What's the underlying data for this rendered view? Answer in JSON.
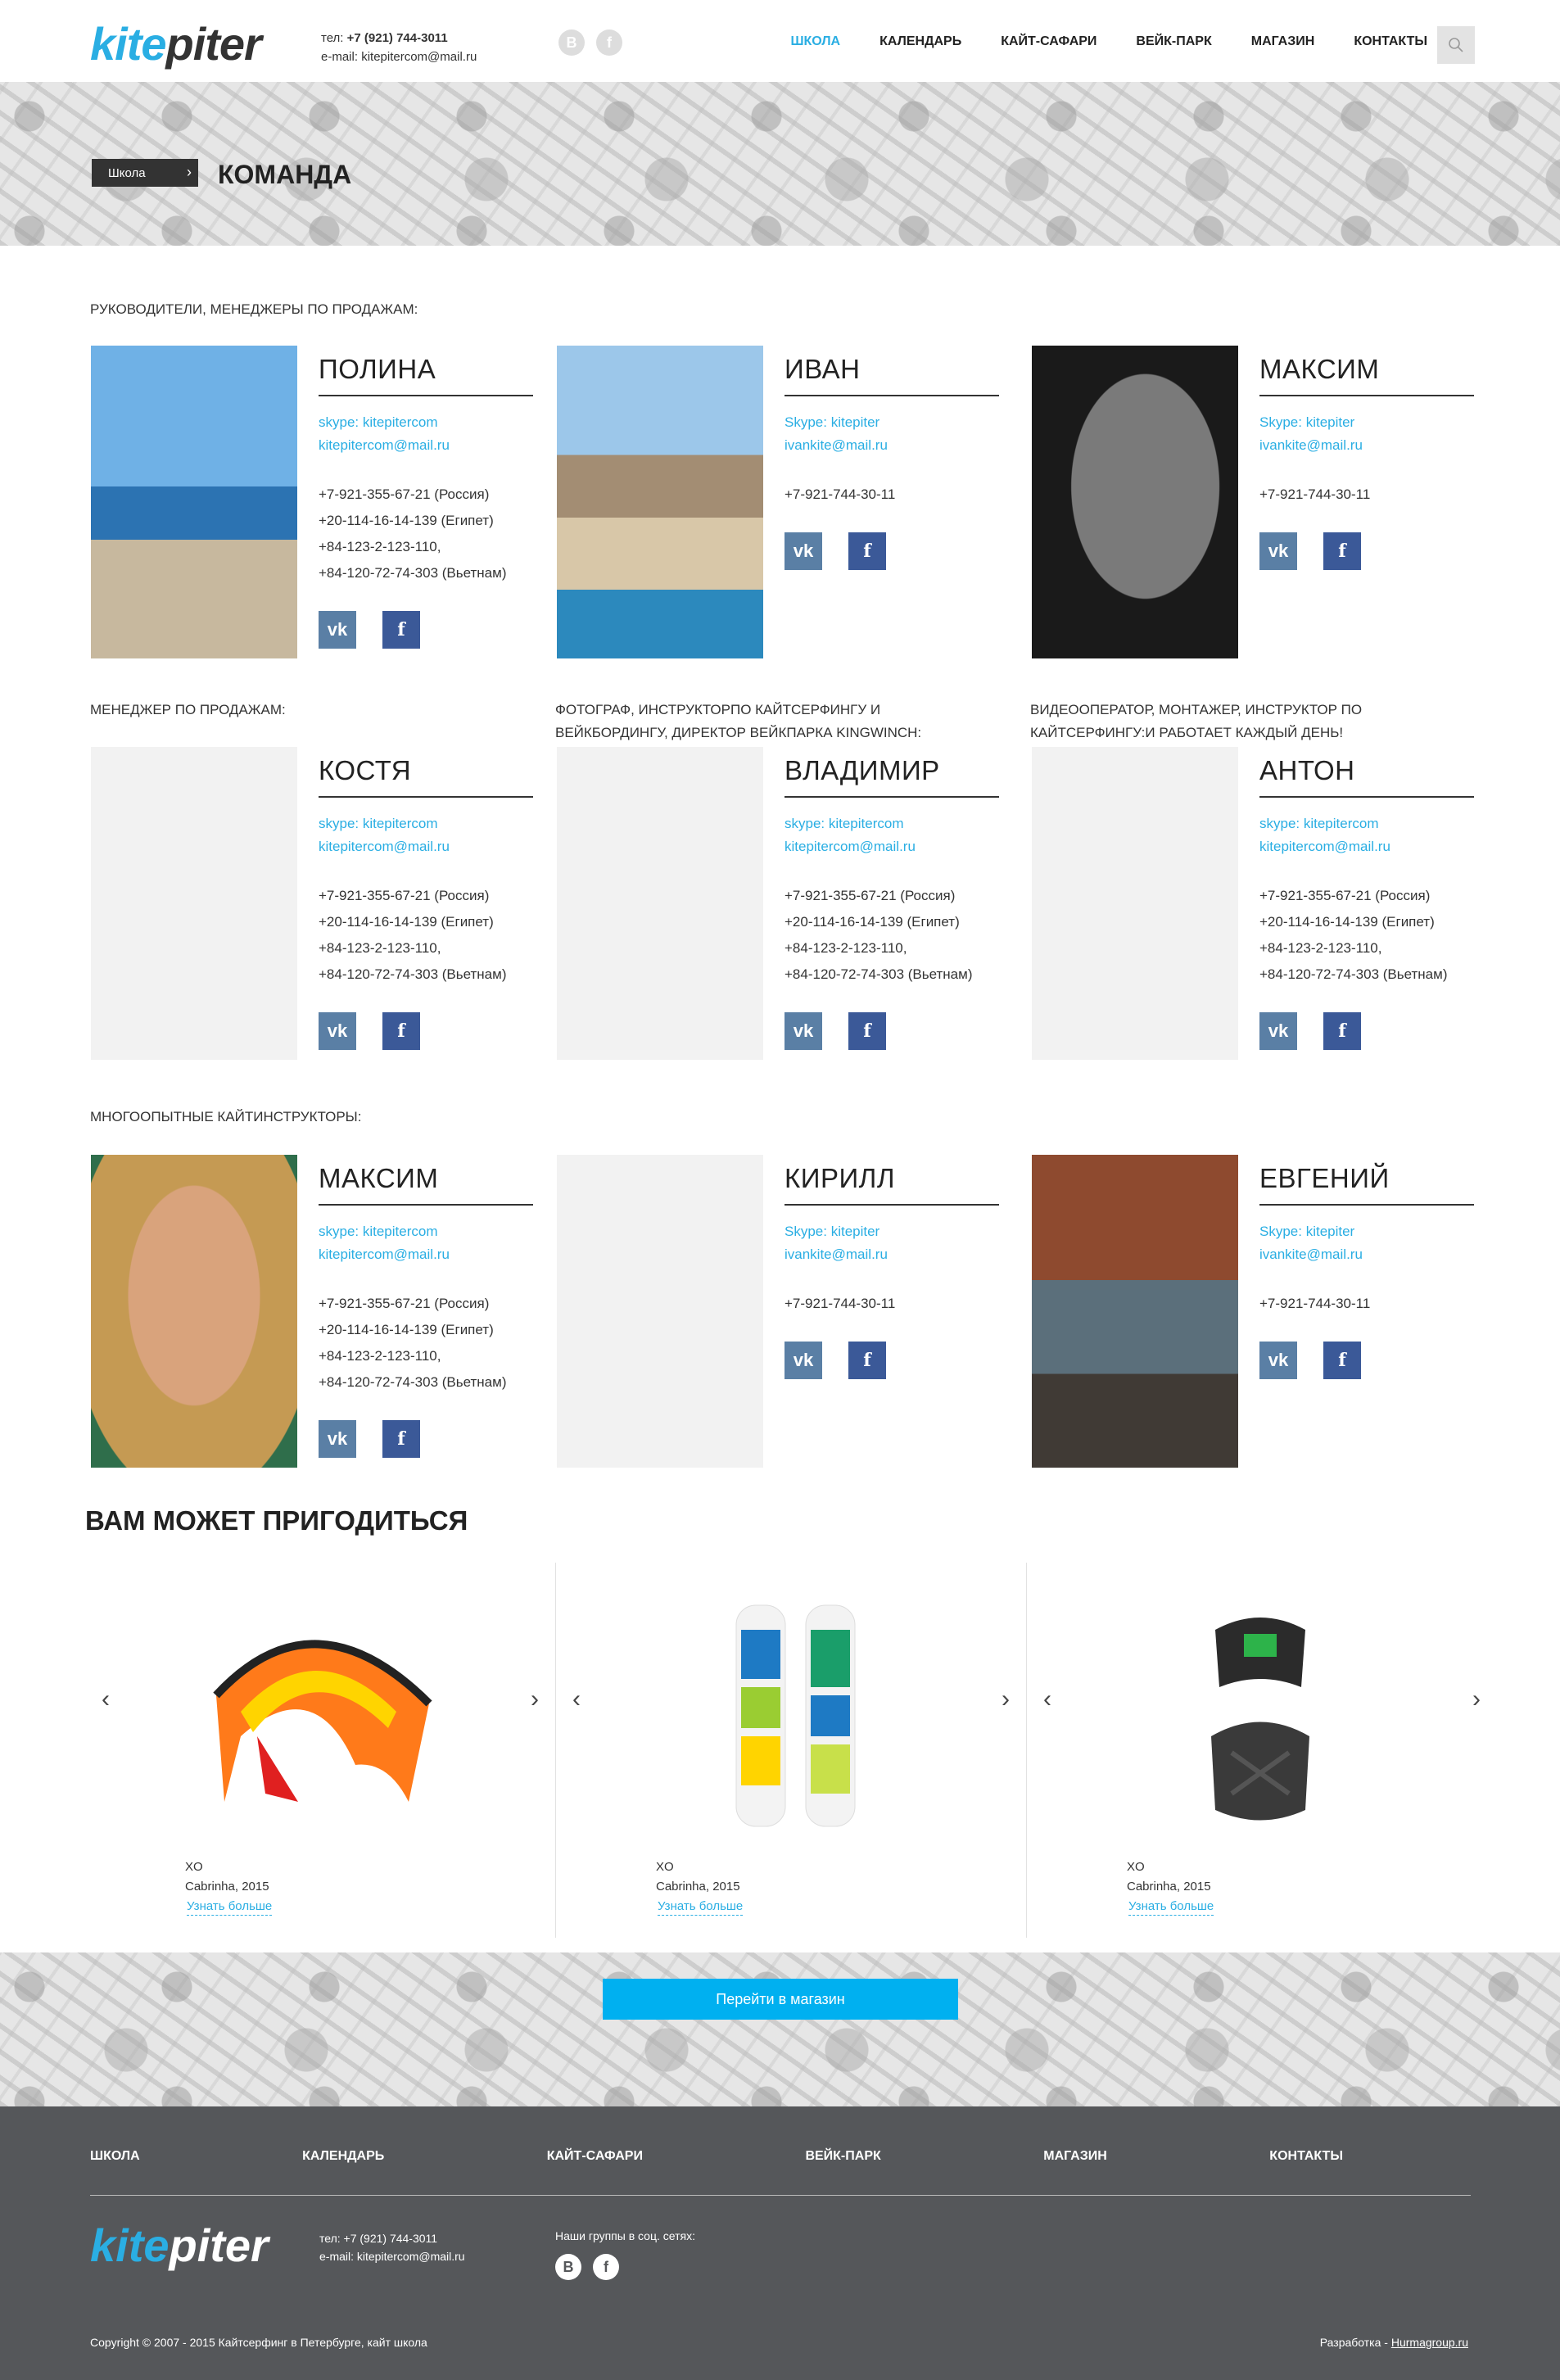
{
  "header": {
    "logo_kite": "kite",
    "logo_piter": "piter",
    "phone_label": "тел:",
    "phone": "+7 (921) 744-3011",
    "email_label": "e-mail:",
    "email": "kitepitercom@mail.ru",
    "social": [
      "В",
      "f"
    ],
    "nav": [
      "ШКОЛА",
      "КАЛЕНДАРЬ",
      "КАЙТ-САФАРИ",
      "ВЕЙК-ПАРК",
      "МАГАЗИН",
      "КОНТАКТЫ"
    ]
  },
  "title_band": {
    "breadcrumb": "Школа",
    "title": "КОМАНДА"
  },
  "team": {
    "group1_label": "РУКОВОДИТЕЛИ, МЕНЕДЖЕРЫ ПО ПРОДАЖАМ:",
    "group2a_label": "МЕНЕДЖЕР ПО ПРОДАЖАМ:",
    "group2b_label": "ФОТОГРАФ, ИНСТРУКТОРПО КАЙТСЕРФИНГУ И ВЕЙКБОРДИНГУ, ДИРЕКТОР ВЕЙКПАРКА KINGWINCH:",
    "group2c_label": "ВИДЕООПЕРАТОР, МОНТАЖЕР, ИНСТРУКТОР ПО КАЙТСЕРФИНГУ:и работает каждый день!",
    "group3_label": "МНОГООПЫТНЫЕ КАЙТИНСТРУКТОРЫ:",
    "members": [
      {
        "name": "ПОЛИНА",
        "skype": "skype: kitepitercom",
        "email": "kitepitercom@mail.ru",
        "phones": [
          "+7-921-355-67-21  (Россия)",
          "+20-114-16-14-139  (Египет)",
          "+84-123-2-123-110,",
          "+84-120-72-74-303  (Вьетнам)"
        ]
      },
      {
        "name": "ИВАН",
        "skype": "Skype: kitepiter",
        "email": "ivankite@mail.ru",
        "phones": [
          "+7-921-744-30-11"
        ]
      },
      {
        "name": "МАКСИМ",
        "skype": "Skype: kitepiter",
        "email": "ivankite@mail.ru",
        "phones": [
          "+7-921-744-30-11"
        ]
      },
      {
        "name": "КОСТЯ",
        "skype": "skype: kitepitercom",
        "email": "kitepitercom@mail.ru",
        "phones": [
          "+7-921-355-67-21  (Россия)",
          "+20-114-16-14-139  (Египет)",
          "+84-123-2-123-110,",
          "+84-120-72-74-303  (Вьетнам)"
        ]
      },
      {
        "name": "ВЛАДИМИР",
        "skype": "skype: kitepitercom",
        "email": "kitepitercom@mail.ru",
        "phones": [
          "+7-921-355-67-21  (Россия)",
          "+20-114-16-14-139  (Египет)",
          "+84-123-2-123-110,",
          "+84-120-72-74-303  (Вьетнам)"
        ]
      },
      {
        "name": "АНТОН",
        "skype": "skype: kitepitercom",
        "email": "kitepitercom@mail.ru",
        "phones": [
          "+7-921-355-67-21  (Россия)",
          "+20-114-16-14-139  (Египет)",
          "+84-123-2-123-110,",
          "+84-120-72-74-303  (Вьетнам)"
        ]
      },
      {
        "name": "МАКСИМ",
        "skype": "skype: kitepitercom",
        "email": "kitepitercom@mail.ru",
        "phones": [
          "+7-921-355-67-21  (Россия)",
          "+20-114-16-14-139  (Египет)",
          "+84-123-2-123-110,",
          "+84-120-72-74-303  (Вьетнам)"
        ]
      },
      {
        "name": "КИРИЛЛ",
        "skype": "Skype: kitepiter",
        "email": "ivankite@mail.ru",
        "phones": [
          "+7-921-744-30-11"
        ]
      },
      {
        "name": "ЕВГЕНИЙ",
        "skype": "Skype: kitepiter",
        "email": "ivankite@mail.ru",
        "phones": [
          "+7-921-744-30-11"
        ]
      }
    ],
    "vk_glyph": "vk",
    "fb_glyph": "f"
  },
  "products": {
    "title": "ВАМ МОЖЕТ ПРИГОДИТЬСЯ",
    "items": [
      {
        "name": "XO",
        "brand": "Cabrinha, 2015",
        "more": "Узнать больше",
        "icon": "kite-icon"
      },
      {
        "name": "XO",
        "brand": "Cabrinha, 2015",
        "more": "Узнать больше",
        "icon": "kiteboard-icon"
      },
      {
        "name": "XO",
        "brand": "Cabrinha, 2015",
        "more": "Узнать больше",
        "icon": "harness-icon"
      }
    ],
    "prev": "‹",
    "next": "›",
    "shop_button": "Перейти в магазин"
  },
  "footer": {
    "nav": [
      "ШКОЛА",
      "КАЛЕНДАРЬ",
      "КАЙТ-САФАРИ",
      "ВЕЙК-ПАРК",
      "МАГАЗИН",
      "КОНТАКТЫ"
    ],
    "phone": "тел: +7 (921) 744-3011",
    "email": "e-mail: kitepitercom@mail.ru",
    "social_label": "Наши группы в соц. сетях:",
    "copyright": "Copyright © 2007 - 2015 Кайтсерфинг в Петербурге, кайт школа",
    "dev_label": "Разработка - ",
    "dev_link": "Hurmagroup.ru"
  },
  "colors": {
    "accent": "#2aaee3",
    "button": "#00b0f0",
    "footer_bg": "#55575a",
    "vk": "#5a7fa5",
    "fb": "#3b5998"
  }
}
